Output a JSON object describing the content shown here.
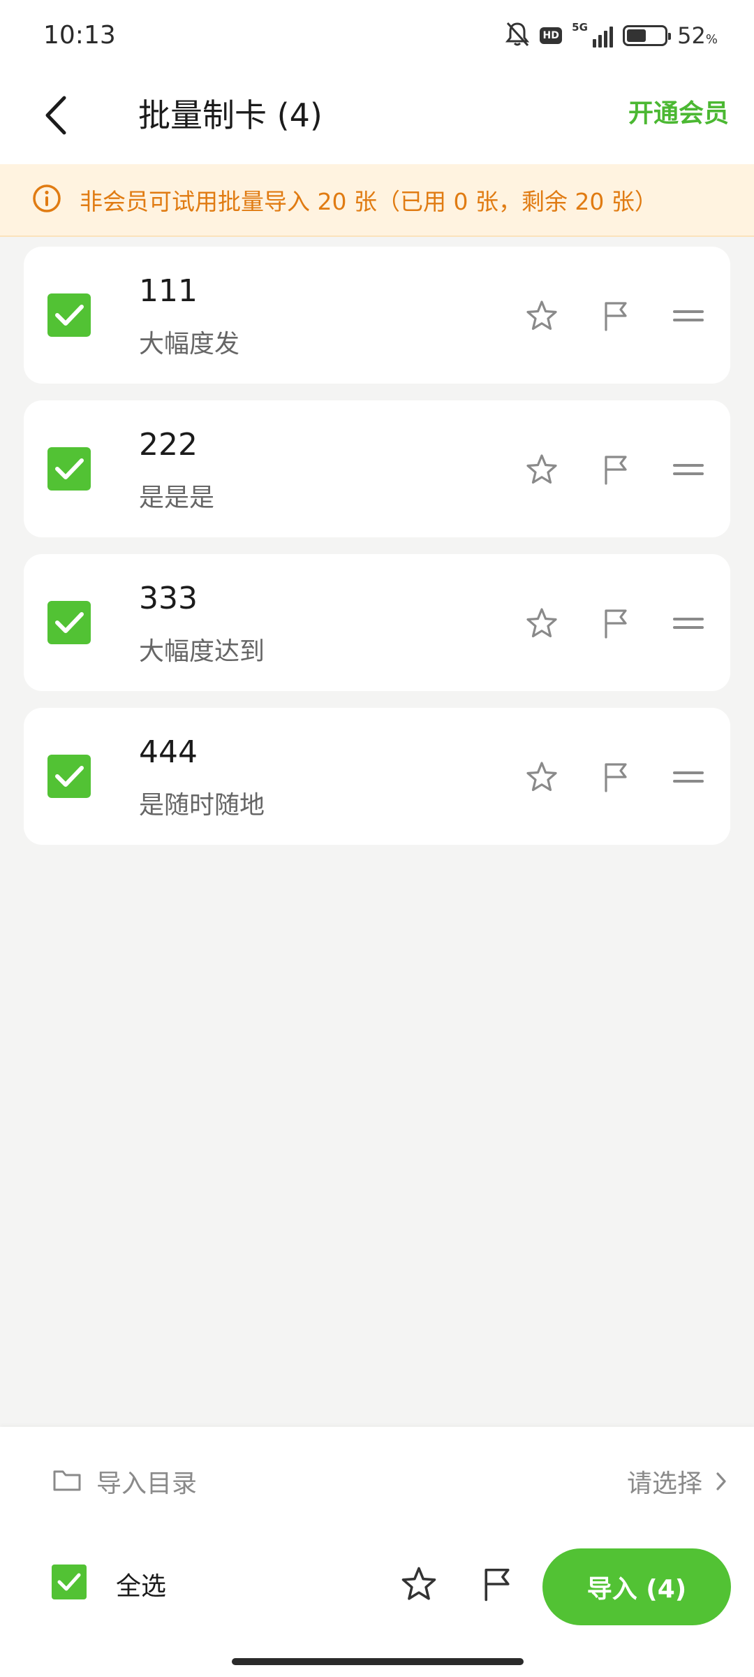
{
  "status_bar": {
    "time": "10:13",
    "network": "5G",
    "hd": "HD",
    "battery_level": 0.52,
    "battery_percent": "52",
    "battery_unit": "%"
  },
  "header": {
    "title": "批量制卡 (4)",
    "vip_link": "开通会员"
  },
  "notice": {
    "text": "非会员可试用批量导入 20 张（已用 0 张，剩余 20 张）"
  },
  "cards": [
    {
      "title": "111",
      "subtitle": "大幅度发",
      "checked": true
    },
    {
      "title": "222",
      "subtitle": "是是是",
      "checked": true
    },
    {
      "title": "333",
      "subtitle": "大幅度达到",
      "checked": true
    },
    {
      "title": "444",
      "subtitle": "是随时随地",
      "checked": true
    }
  ],
  "bottom": {
    "import_dir_label": "导入目录",
    "select_placeholder": "请选择",
    "select_all_label": "全选",
    "import_button": "导入 (4)"
  },
  "colors": {
    "accent": "#52C234",
    "vip_text": "#4BB832",
    "notice_bg": "#FFF3E0",
    "notice_text": "#E07B12"
  }
}
